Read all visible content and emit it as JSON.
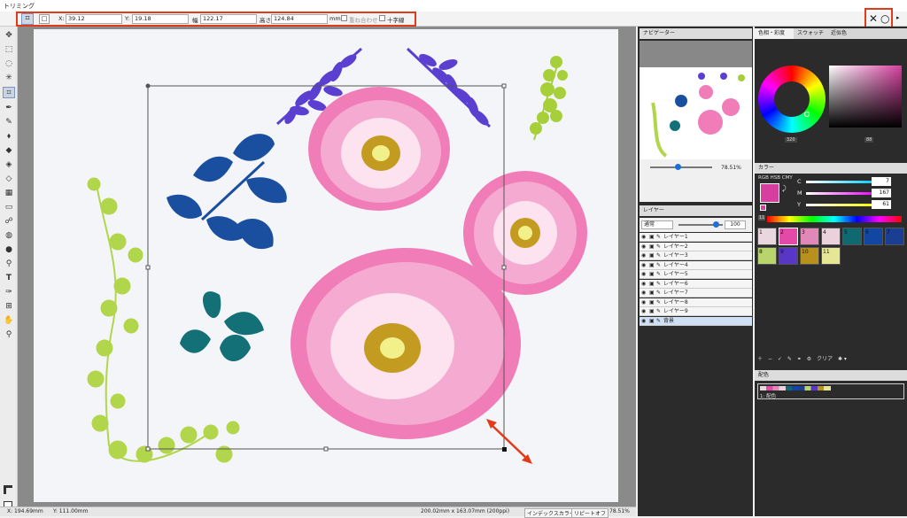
{
  "window": {
    "title": "トリミング"
  },
  "options": {
    "x_label": "X:",
    "x_value": "39.12",
    "y_label": "Y:",
    "y_value": "19.18",
    "w_label": "幅",
    "w_value": "122.17",
    "h_label": "高さ",
    "h_value": "124.84",
    "unit": "mm",
    "overlap_label": "重ね合わせ",
    "crosshair_label": "十字線",
    "cancel_glyph": "✕",
    "ok_glyph": "○"
  },
  "navigator": {
    "tab": "ナビゲーター",
    "zoom": "78.51%"
  },
  "layers": {
    "tab": "レイヤー",
    "blend_mode": "通常",
    "opacity": "100",
    "items": [
      "レイヤー1",
      "レイヤー2",
      "レイヤー3",
      "レイヤー4",
      "レイヤー5",
      "レイヤー6",
      "レイヤー7",
      "レイヤー8",
      "レイヤー9",
      "背景"
    ]
  },
  "color_panel": {
    "tabs": [
      "色相・彩度",
      "スウォッチ",
      "近似色"
    ],
    "hue_value": "320",
    "sv_value": "88",
    "mixer_tab": "カラー",
    "modes": "RGB HSB CMY",
    "c_label": "C",
    "c_value": "7",
    "m_label": "M",
    "m_value": "167",
    "y_label": "Y",
    "y_value": "61",
    "palette_count": "11",
    "clear_label": "クリア",
    "main_color": "#d63fa0"
  },
  "palette": {
    "swatches": [
      {
        "num": "1",
        "color": "#e8d7de"
      },
      {
        "num": "2",
        "color": "#e34aa8"
      },
      {
        "num": "3",
        "color": "#e088b8"
      },
      {
        "num": "4",
        "color": "#ead1dc"
      },
      {
        "num": "5",
        "color": "#0e6a70"
      },
      {
        "num": "6",
        "color": "#1147a3"
      },
      {
        "num": "7",
        "color": "#1a3f92"
      },
      {
        "num": "8",
        "color": "#b8d46a"
      },
      {
        "num": "9",
        "color": "#5a36c7"
      },
      {
        "num": "10",
        "color": "#b8901e"
      },
      {
        "num": "11",
        "color": "#e6e695"
      }
    ]
  },
  "haishoku": {
    "tab": "配色",
    "item": "1: 配色"
  },
  "status": {
    "x": "X: 194.69mm",
    "y": "Y: 111.00mm",
    "docsize": "200.02mm x 163.07mm (200ppi)",
    "color_mode": "インデックスカラー",
    "repeat": "リピートオフ",
    "zoom": "78.51%"
  }
}
